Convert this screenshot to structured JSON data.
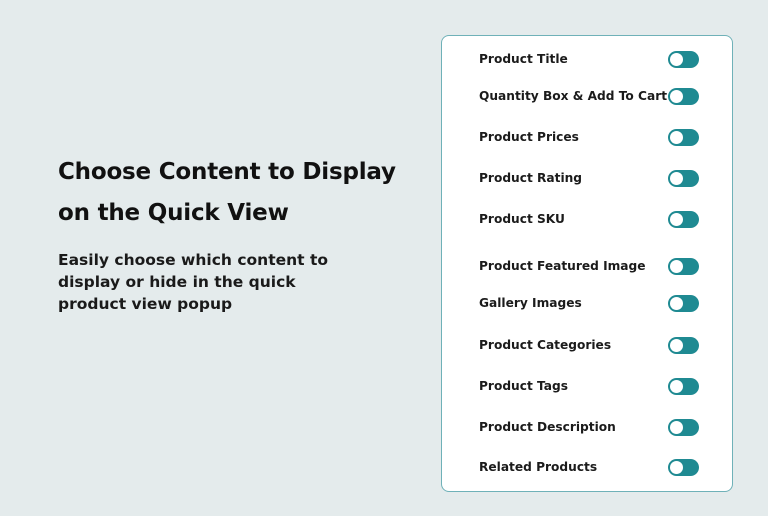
{
  "hero": {
    "title": "Choose Content to Display on the Quick View",
    "subtitle": "Easily choose which content to display or hide in the quick product view popup"
  },
  "settings": {
    "toggle_color": "#1f8a92",
    "items": [
      {
        "label": "Product Title",
        "enabled": true
      },
      {
        "label": "Quantity Box & Add To Cart",
        "enabled": true
      },
      {
        "label": "Product Prices",
        "enabled": true
      },
      {
        "label": "Product Rating",
        "enabled": true
      },
      {
        "label": "Product SKU",
        "enabled": true
      },
      {
        "label": "Product Featured Image",
        "enabled": true
      },
      {
        "label": "Gallery Images",
        "enabled": true
      },
      {
        "label": "Product Categories",
        "enabled": true
      },
      {
        "label": "Product Tags",
        "enabled": true
      },
      {
        "label": "Product Description",
        "enabled": true
      },
      {
        "label": "Related Products",
        "enabled": true
      }
    ]
  }
}
